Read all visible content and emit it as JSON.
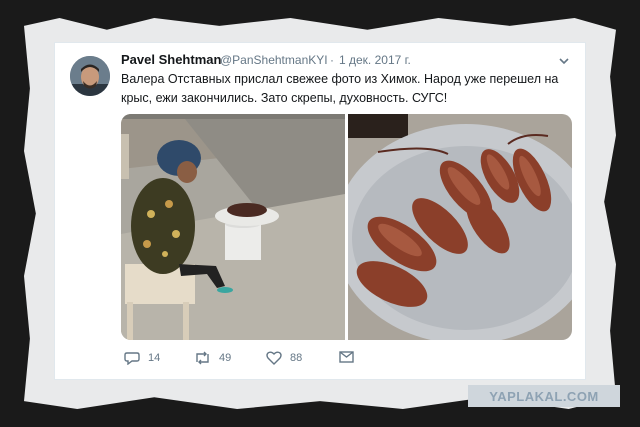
{
  "tweet": {
    "author_name": "Pavel Shehtman",
    "handle": "@PanShehtmanKYI",
    "separator": "·",
    "date": "1 дек. 2017 г.",
    "text_line1": "Валера Отставных прислал свежее фото из Химок. Народ уже перешел на",
    "text_line2": "крыс, ежи закончились. Зато скрепы, духовность. СУГС!"
  },
  "actions": {
    "replies": "14",
    "retweets": "49",
    "likes": "88"
  },
  "icons": {
    "reply": "reply-icon",
    "retweet": "retweet-icon",
    "like": "heart-icon",
    "dm": "envelope-icon",
    "menu": "chevron-down-icon"
  },
  "colors": {
    "text": "#14171a",
    "secondary": "#657786",
    "border": "#e1e8ed"
  },
  "watermark": "YAPLAKAL.COM"
}
